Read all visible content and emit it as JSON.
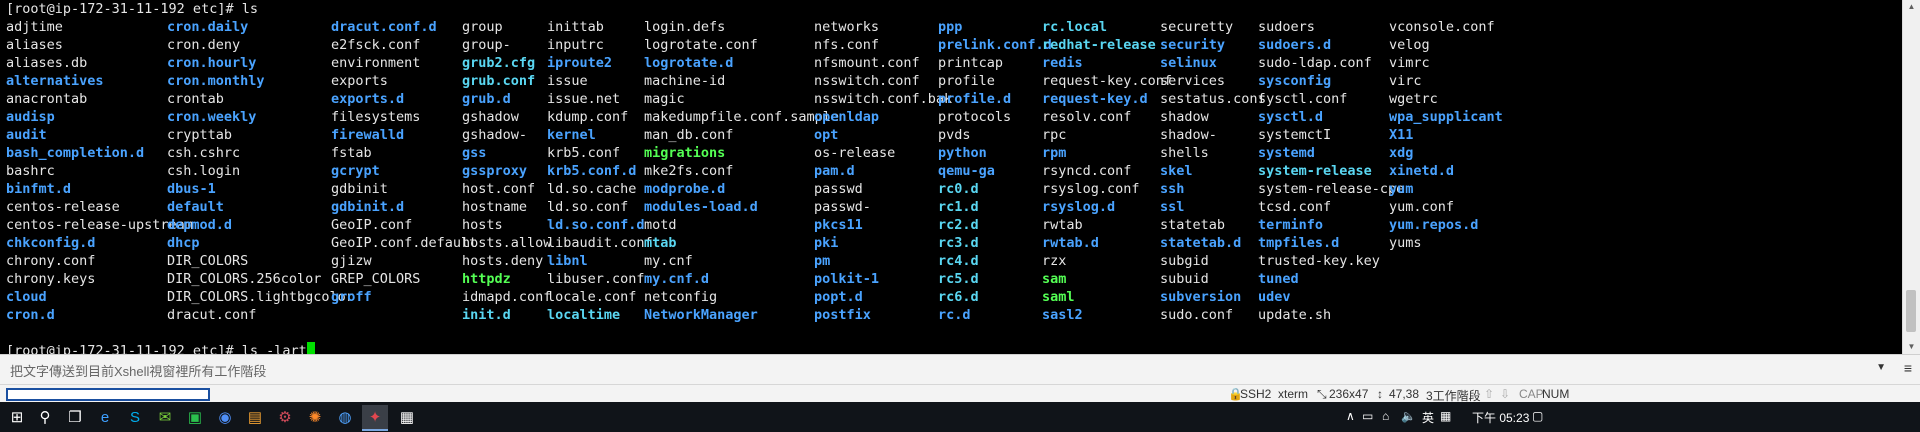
{
  "terminal": {
    "prompt1": "[root@ip-172-31-11-192 etc]# ls",
    "prompt2": "[root@ip-172-31-11-192 etc]# ls -lart",
    "columns": [
      [
        {
          "n": "adjtime",
          "t": "f"
        },
        {
          "n": "aliases",
          "t": "f"
        },
        {
          "n": "aliases.db",
          "t": "f"
        },
        {
          "n": "alternatives",
          "t": "d"
        },
        {
          "n": "anacrontab",
          "t": "f"
        },
        {
          "n": "audisp",
          "t": "d"
        },
        {
          "n": "audit",
          "t": "d"
        },
        {
          "n": "bash_completion.d",
          "t": "d"
        },
        {
          "n": "bashrc",
          "t": "f"
        },
        {
          "n": "binfmt.d",
          "t": "d"
        },
        {
          "n": "centos-release",
          "t": "f"
        },
        {
          "n": "centos-release-upstream",
          "t": "f"
        },
        {
          "n": "chkconfig.d",
          "t": "d"
        },
        {
          "n": "chrony.conf",
          "t": "f"
        },
        {
          "n": "chrony.keys",
          "t": "f"
        },
        {
          "n": "cloud",
          "t": "d"
        },
        {
          "n": "cron.d",
          "t": "d"
        }
      ],
      [
        {
          "n": "cron.daily",
          "t": "d"
        },
        {
          "n": "cron.deny",
          "t": "f"
        },
        {
          "n": "cron.hourly",
          "t": "d"
        },
        {
          "n": "cron.monthly",
          "t": "d"
        },
        {
          "n": "crontab",
          "t": "f"
        },
        {
          "n": "cron.weekly",
          "t": "d"
        },
        {
          "n": "crypttab",
          "t": "f"
        },
        {
          "n": "csh.cshrc",
          "t": "f"
        },
        {
          "n": "csh.login",
          "t": "f"
        },
        {
          "n": "dbus-1",
          "t": "d"
        },
        {
          "n": "default",
          "t": "d"
        },
        {
          "n": "depmod.d",
          "t": "d"
        },
        {
          "n": "dhcp",
          "t": "d"
        },
        {
          "n": "DIR_COLORS",
          "t": "f"
        },
        {
          "n": "DIR_COLORS.256color",
          "t": "f"
        },
        {
          "n": "DIR_COLORS.lightbgcolor",
          "t": "f"
        },
        {
          "n": "dracut.conf",
          "t": "f"
        }
      ],
      [
        {
          "n": "dracut.conf.d",
          "t": "d"
        },
        {
          "n": "e2fsck.conf",
          "t": "f"
        },
        {
          "n": "environment",
          "t": "f"
        },
        {
          "n": "exports",
          "t": "f"
        },
        {
          "n": "exports.d",
          "t": "d"
        },
        {
          "n": "filesystems",
          "t": "f"
        },
        {
          "n": "firewalld",
          "t": "d"
        },
        {
          "n": "fstab",
          "t": "f"
        },
        {
          "n": "gcrypt",
          "t": "d"
        },
        {
          "n": "gdbinit",
          "t": "f"
        },
        {
          "n": "gdbinit.d",
          "t": "d"
        },
        {
          "n": "GeoIP.conf",
          "t": "f"
        },
        {
          "n": "GeoIP.conf.default",
          "t": "f"
        },
        {
          "n": "gjizw",
          "t": "f"
        },
        {
          "n": "GREP_COLORS",
          "t": "f"
        },
        {
          "n": "groff",
          "t": "d"
        }
      ],
      [
        {
          "n": "group",
          "t": "f"
        },
        {
          "n": "group-",
          "t": "f"
        },
        {
          "n": "grub2.cfg",
          "t": "l"
        },
        {
          "n": "grub.conf",
          "t": "l"
        },
        {
          "n": "grub.d",
          "t": "d"
        },
        {
          "n": "gshadow",
          "t": "f"
        },
        {
          "n": "gshadow-",
          "t": "f"
        },
        {
          "n": "gss",
          "t": "d"
        },
        {
          "n": "gssproxy",
          "t": "d"
        },
        {
          "n": "host.conf",
          "t": "f"
        },
        {
          "n": "hostname",
          "t": "f"
        },
        {
          "n": "hosts",
          "t": "f"
        },
        {
          "n": "hosts.allow",
          "t": "f"
        },
        {
          "n": "hosts.deny",
          "t": "f"
        },
        {
          "n": "httpdz",
          "t": "x"
        },
        {
          "n": "idmapd.conf",
          "t": "f"
        },
        {
          "n": "init.d",
          "t": "l"
        }
      ],
      [
        {
          "n": "inittab",
          "t": "f"
        },
        {
          "n": "inputrc",
          "t": "f"
        },
        {
          "n": "iproute2",
          "t": "d"
        },
        {
          "n": "issue",
          "t": "f"
        },
        {
          "n": "issue.net",
          "t": "f"
        },
        {
          "n": "kdump.conf",
          "t": "f"
        },
        {
          "n": "kernel",
          "t": "d"
        },
        {
          "n": "krb5.conf",
          "t": "f"
        },
        {
          "n": "krb5.conf.d",
          "t": "d"
        },
        {
          "n": "ld.so.cache",
          "t": "f"
        },
        {
          "n": "ld.so.conf",
          "t": "f"
        },
        {
          "n": "ld.so.conf.d",
          "t": "d"
        },
        {
          "n": "libaudit.conf",
          "t": "f"
        },
        {
          "n": "libnl",
          "t": "d"
        },
        {
          "n": "libuser.conf",
          "t": "f"
        },
        {
          "n": "locale.conf",
          "t": "f"
        },
        {
          "n": "localtime",
          "t": "l"
        }
      ],
      [
        {
          "n": "login.defs",
          "t": "f"
        },
        {
          "n": "logrotate.conf",
          "t": "f"
        },
        {
          "n": "logrotate.d",
          "t": "d"
        },
        {
          "n": "machine-id",
          "t": "f"
        },
        {
          "n": "magic",
          "t": "f"
        },
        {
          "n": "makedumpfile.conf.sample",
          "t": "f"
        },
        {
          "n": "man_db.conf",
          "t": "f"
        },
        {
          "n": "migrations",
          "t": "x"
        },
        {
          "n": "mke2fs.conf",
          "t": "f"
        },
        {
          "n": "modprobe.d",
          "t": "d"
        },
        {
          "n": "modules-load.d",
          "t": "d"
        },
        {
          "n": "motd",
          "t": "f"
        },
        {
          "n": "mtab",
          "t": "l"
        },
        {
          "n": "my.cnf",
          "t": "f"
        },
        {
          "n": "my.cnf.d",
          "t": "d"
        },
        {
          "n": "netconfig",
          "t": "f"
        },
        {
          "n": "NetworkManager",
          "t": "d"
        }
      ],
      [
        {
          "n": "networks",
          "t": "f"
        },
        {
          "n": "nfs.conf",
          "t": "f"
        },
        {
          "n": "nfsmount.conf",
          "t": "f"
        },
        {
          "n": "nsswitch.conf",
          "t": "f"
        },
        {
          "n": "nsswitch.conf.bak",
          "t": "f"
        },
        {
          "n": "openldap",
          "t": "d"
        },
        {
          "n": "opt",
          "t": "d"
        },
        {
          "n": "os-release",
          "t": "f"
        },
        {
          "n": "pam.d",
          "t": "d"
        },
        {
          "n": "passwd",
          "t": "f"
        },
        {
          "n": "passwd-",
          "t": "f"
        },
        {
          "n": "pkcs11",
          "t": "d"
        },
        {
          "n": "pki",
          "t": "d"
        },
        {
          "n": "pm",
          "t": "d"
        },
        {
          "n": "polkit-1",
          "t": "d"
        },
        {
          "n": "popt.d",
          "t": "d"
        },
        {
          "n": "postfix",
          "t": "d"
        }
      ],
      [
        {
          "n": "ppp",
          "t": "d"
        },
        {
          "n": "prelink.conf.d",
          "t": "d"
        },
        {
          "n": "printcap",
          "t": "f"
        },
        {
          "n": "profile",
          "t": "f"
        },
        {
          "n": "profile.d",
          "t": "d"
        },
        {
          "n": "protocols",
          "t": "f"
        },
        {
          "n": "pvds",
          "t": "f"
        },
        {
          "n": "python",
          "t": "d"
        },
        {
          "n": "qemu-ga",
          "t": "d"
        },
        {
          "n": "rc0.d",
          "t": "l"
        },
        {
          "n": "rc1.d",
          "t": "l"
        },
        {
          "n": "rc2.d",
          "t": "l"
        },
        {
          "n": "rc3.d",
          "t": "l"
        },
        {
          "n": "rc4.d",
          "t": "l"
        },
        {
          "n": "rc5.d",
          "t": "l"
        },
        {
          "n": "rc6.d",
          "t": "l"
        },
        {
          "n": "rc.d",
          "t": "d"
        }
      ],
      [
        {
          "n": "rc.local",
          "t": "l"
        },
        {
          "n": "redhat-release",
          "t": "l"
        },
        {
          "n": "redis",
          "t": "d"
        },
        {
          "n": "request-key.conf",
          "t": "f"
        },
        {
          "n": "request-key.d",
          "t": "d"
        },
        {
          "n": "resolv.conf",
          "t": "f"
        },
        {
          "n": "rpc",
          "t": "f"
        },
        {
          "n": "rpm",
          "t": "d"
        },
        {
          "n": "rsyncd.conf",
          "t": "f"
        },
        {
          "n": "rsyslog.conf",
          "t": "f"
        },
        {
          "n": "rsyslog.d",
          "t": "d"
        },
        {
          "n": "rwtab",
          "t": "f"
        },
        {
          "n": "rwtab.d",
          "t": "d"
        },
        {
          "n": "rzx",
          "t": "f"
        },
        {
          "n": "sam",
          "t": "x"
        },
        {
          "n": "saml",
          "t": "x"
        },
        {
          "n": "sasl2",
          "t": "d"
        }
      ],
      [
        {
          "n": "securetty",
          "t": "f"
        },
        {
          "n": "security",
          "t": "d"
        },
        {
          "n": "selinux",
          "t": "d"
        },
        {
          "n": "services",
          "t": "f"
        },
        {
          "n": "sestatus.conf",
          "t": "f"
        },
        {
          "n": "shadow",
          "t": "f"
        },
        {
          "n": "shadow-",
          "t": "f"
        },
        {
          "n": "shells",
          "t": "f"
        },
        {
          "n": "skel",
          "t": "d"
        },
        {
          "n": "ssh",
          "t": "d"
        },
        {
          "n": "ssl",
          "t": "d"
        },
        {
          "n": "statetab",
          "t": "f"
        },
        {
          "n": "statetab.d",
          "t": "d"
        },
        {
          "n": "subgid",
          "t": "f"
        },
        {
          "n": "subuid",
          "t": "f"
        },
        {
          "n": "subversion",
          "t": "d"
        },
        {
          "n": "sudo.conf",
          "t": "f"
        }
      ],
      [
        {
          "n": "sudoers",
          "t": "f"
        },
        {
          "n": "sudoers.d",
          "t": "d"
        },
        {
          "n": "sudo-ldap.conf",
          "t": "f"
        },
        {
          "n": "sysconfig",
          "t": "d"
        },
        {
          "n": "sysctl.conf",
          "t": "f"
        },
        {
          "n": "sysctl.d",
          "t": "d"
        },
        {
          "n": "systemctI",
          "t": "f"
        },
        {
          "n": "systemd",
          "t": "d"
        },
        {
          "n": "system-release",
          "t": "l"
        },
        {
          "n": "system-release-cpe",
          "t": "f"
        },
        {
          "n": "tcsd.conf",
          "t": "f"
        },
        {
          "n": "terminfo",
          "t": "d"
        },
        {
          "n": "tmpfiles.d",
          "t": "d"
        },
        {
          "n": "trusted-key.key",
          "t": "f"
        },
        {
          "n": "tuned",
          "t": "d"
        },
        {
          "n": "udev",
          "t": "d"
        },
        {
          "n": "update.sh",
          "t": "f"
        }
      ],
      [
        {
          "n": "vconsole.conf",
          "t": "f"
        },
        {
          "n": "velog",
          "t": "f"
        },
        {
          "n": "vimrc",
          "t": "f"
        },
        {
          "n": "virc",
          "t": "f"
        },
        {
          "n": "wgetrc",
          "t": "f"
        },
        {
          "n": "wpa_supplicant",
          "t": "d"
        },
        {
          "n": "X11",
          "t": "d"
        },
        {
          "n": "xdg",
          "t": "d"
        },
        {
          "n": "xinetd.d",
          "t": "d"
        },
        {
          "n": "yum",
          "t": "d"
        },
        {
          "n": "yum.conf",
          "t": "f"
        },
        {
          "n": "yum.repos.d",
          "t": "d"
        },
        {
          "n": "yums",
          "t": "f"
        }
      ]
    ]
  },
  "sendbar": {
    "hint": "把文字傳送到目前Xshell視窗裡所有工作階段",
    "dropdown": "▼",
    "menu": "≡"
  },
  "status": {
    "ssh": "SSH2",
    "term": "xterm",
    "size": "236x47",
    "pos": "47,38",
    "sessions": "3工作階段",
    "cap": "CAP",
    "num": "NUM"
  },
  "tray": {
    "ime": "英",
    "time": "下午 05:23"
  },
  "colors": {
    "dir": "#4aa3ff",
    "exe": "#54ff54",
    "link": "#5ad7f2"
  }
}
